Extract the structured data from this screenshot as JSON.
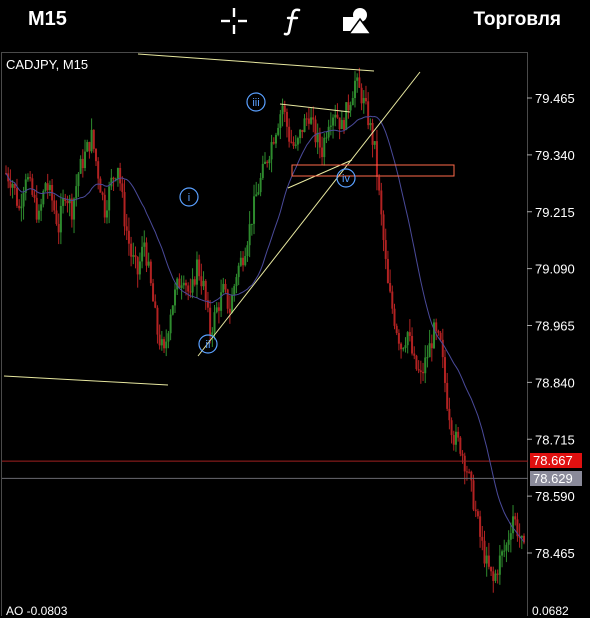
{
  "toolbar": {
    "timeframe_label": "M15",
    "crosshair_icon": "crosshair-icon",
    "indicators_icon": "function-icon",
    "objects_icon": "shapes-icon",
    "trade_label": "Торговля"
  },
  "chart": {
    "symbol_label": "CADJPY, M15",
    "background": "#000000",
    "frame_color": "#4a4a4a",
    "bull_color": "#2e8b2e",
    "bear_color": "#b22222",
    "ma_color": "#4a4a9a",
    "trendline_color": "#e8e8a0",
    "zone_color": "#ff6a4a",
    "wave_label_color": "#5aa0ff",
    "price_axis": [
      "79.465",
      "79.340",
      "79.215",
      "79.090",
      "78.965",
      "78.840",
      "78.715",
      "78.590",
      "78.465"
    ],
    "bid_price_tag": "78.667",
    "bid_tag_color": "#e01010",
    "ask_price_tag": "78.629",
    "ask_tag_color": "#8a8a9a",
    "wave_labels": [
      "i",
      "ii",
      "iii",
      "iv"
    ],
    "indicator_label": "AO -0.0803",
    "indicator_right_value": "0.0682"
  },
  "chart_data": {
    "type": "candlestick",
    "symbol": "CADJPY",
    "timeframe": "M15",
    "ylim": [
      78.38,
      79.55
    ],
    "price_ticks": [
      79.465,
      79.34,
      79.215,
      79.09,
      78.965,
      78.84,
      78.715,
      78.59,
      78.465
    ],
    "close_path": [
      79.3,
      79.28,
      79.22,
      79.3,
      79.25,
      79.2,
      79.28,
      79.24,
      79.18,
      79.26,
      79.22,
      79.3,
      79.34,
      79.38,
      79.3,
      79.22,
      79.28,
      79.32,
      79.2,
      79.12,
      79.08,
      79.15,
      79.05,
      78.95,
      78.9,
      79.0,
      79.05,
      79.08,
      79.02,
      79.1,
      79.05,
      78.95,
      79.0,
      79.04,
      79.0,
      79.08,
      79.12,
      79.18,
      79.25,
      79.3,
      79.35,
      79.4,
      79.45,
      79.38,
      79.35,
      79.4,
      79.43,
      79.38,
      79.35,
      79.42,
      79.44,
      79.4,
      79.45,
      79.5,
      79.47,
      79.42,
      79.35,
      79.2,
      79.05,
      78.98,
      78.92,
      78.95,
      78.88,
      78.85,
      78.9,
      78.95,
      78.92,
      78.8,
      78.72,
      78.7,
      78.65,
      78.58,
      78.5,
      78.44,
      78.4,
      78.45,
      78.48,
      78.55,
      78.5,
      78.45
    ],
    "horizontal_levels": [
      {
        "name": "bid",
        "value": 78.667
      },
      {
        "name": "ask",
        "value": 78.629
      }
    ]
  }
}
